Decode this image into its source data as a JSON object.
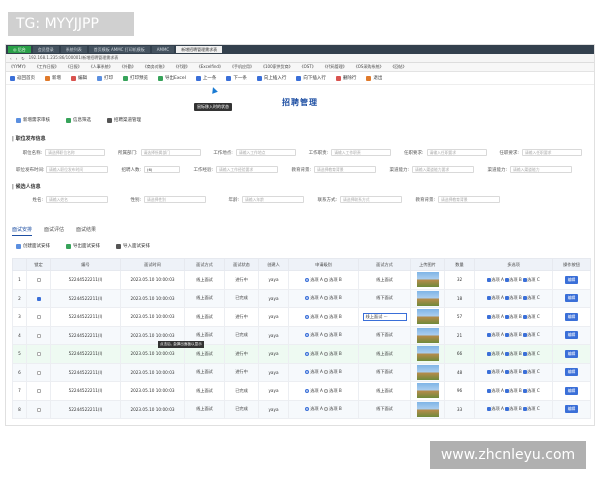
{
  "overlay": {
    "tag": "TG: MYYJJPP",
    "watermark": "www.zhcnleyu.com"
  },
  "browser": {
    "tabs": [
      "◎ 后台",
      "会员登录",
      "系统列表",
      "首页模板 AMMC 打印机模板",
      "AMMC",
      "新增招聘管理需求表"
    ],
    "address": "192.168.1.235:86/100001/新增招聘管理需求表",
    "bookmarks": [
      "《YYMY》",
      "《工作日报》",
      "《日报》",
      "《人事系统》",
      "《外勤》",
      "《商务对账》",
      "《代理》",
      "《Excelfind》",
      "《手机应用》",
      "《100家供货商》",
      "《OST》",
      "《代码管理》",
      "《OS采购系统》",
      "《回帖》"
    ]
  },
  "toolbar": {
    "items": [
      "返回首页",
      "新增",
      "编辑",
      "打印",
      "打印预览",
      "导出Excel",
      "上一条",
      "下一条",
      "向上插入行",
      "向下插入行",
      "删除行",
      "退出"
    ]
  },
  "tooltip": "鼠标移入时的状态",
  "page": {
    "title": "招聘管理"
  },
  "actions": [
    "新增需求审核",
    "信息筛选",
    "招聘渠道管理"
  ],
  "sections": {
    "job_info": "职位发布信息",
    "candidate": "候选人信息"
  },
  "job_form": {
    "row1": [
      {
        "label": "职位名称:",
        "placeholder": "请选择职位名称"
      },
      {
        "label": "所属部门:",
        "placeholder": "请选择所属部门"
      },
      {
        "label": "工作地点:",
        "placeholder": "请输入工作地点"
      },
      {
        "label": "工作职责:",
        "placeholder": "请输入工作职责"
      },
      {
        "label": "任职要求:",
        "placeholder": "请输入任职要求"
      },
      {
        "label": "任职要求:",
        "placeholder": "请输入任职要求"
      }
    ],
    "row2": [
      {
        "label": "职位发布时间:",
        "placeholder": "请输入职位发布时间"
      },
      {
        "label": "招聘人数:",
        "value": "(6)"
      },
      {
        "label": "工作经验:",
        "placeholder": "请输入工作经验要求"
      },
      {
        "label": "教育背景:",
        "placeholder": "请选择教育背景"
      },
      {
        "label": "渠道能力:",
        "placeholder": "请输入渠道能力要求"
      },
      {
        "label": "渠道能力:",
        "placeholder": "请输入渠道能力"
      }
    ]
  },
  "candidate_form": [
    {
      "label": "姓名:",
      "placeholder": "请输入姓名"
    },
    {
      "label": "性别:",
      "placeholder": "请选择性别"
    },
    {
      "label": "年龄:",
      "placeholder": "请输入年龄"
    },
    {
      "label": "联系方式:",
      "placeholder": "请选择联系方式"
    },
    {
      "label": "教育背景:",
      "placeholder": "请选择教育背景"
    }
  ],
  "lower_tabs": [
    "面试安排",
    "面试评估",
    "面试结果"
  ],
  "lower_actions": [
    "创建面试安排",
    "导出面试安排",
    "导入面试安排"
  ],
  "table": {
    "headers": [
      "",
      "锁定",
      "编号",
      "面试时间",
      "面试方式",
      "面试状态",
      "创建人",
      "申请级别",
      "面试方式",
      "上传图片",
      "数量",
      "多选项",
      "操作按钮"
    ],
    "rows": [
      {
        "n": "1",
        "code": "52244522211(I)",
        "time": "2023.05.10 10:00:03",
        "mode": "线上面试",
        "status": "进行中",
        "creator": "yaya",
        "level": "A",
        "way": "线上面试",
        "qty": "32"
      },
      {
        "n": "2",
        "code": "52244522211(I)",
        "time": "2023.05.10 10:00:03",
        "mode": "线上面试",
        "status": "已完成",
        "creator": "yaya",
        "level": "A",
        "way": "线下面试",
        "qty": "18"
      },
      {
        "n": "3",
        "code": "52244522211(I)",
        "time": "2023.05.10 10:00:03",
        "mode": "线上面试",
        "status": "进行中",
        "creator": "yaya",
        "level": "A",
        "way": "线上面试",
        "qty": "57"
      },
      {
        "n": "4",
        "code": "52244522211(I)",
        "time": "2023.05.10 10:00:03",
        "mode": "线上面试",
        "status": "已完成",
        "creator": "yaya",
        "level": "A",
        "way": "线下面试",
        "qty": "21"
      },
      {
        "n": "5",
        "code": "52244522211(I)",
        "time": "2023.05.10 10:00:03",
        "mode": "线上面试",
        "status": "进行中",
        "creator": "yaya",
        "level": "A",
        "way": "线上面试",
        "qty": "66"
      },
      {
        "n": "6",
        "code": "52244522211(I)",
        "time": "2023.05.10 10:00:03",
        "mode": "线上面试",
        "status": "进行中",
        "creator": "yaya",
        "level": "A",
        "way": "线下面试",
        "qty": "48"
      },
      {
        "n": "7",
        "code": "52244522211(I)",
        "time": "2023.05.10 10:00:03",
        "mode": "线上面试",
        "status": "已完成",
        "creator": "yaya",
        "level": "A",
        "way": "线上面试",
        "qty": "96"
      },
      {
        "n": "8",
        "code": "52244522211(I)",
        "time": "2023.05.10 10:00:03",
        "mode": "线上面试",
        "status": "已完成",
        "creator": "yaya",
        "level": "A",
        "way": "线下面试",
        "qty": "33"
      }
    ],
    "radio_a": "选项 A",
    "radio_b": "选项 B",
    "check_a": "选项 A",
    "check_b": "选项 B",
    "check_c": "选项 C",
    "edit": "编辑",
    "tip": "点击后, 会弹出面板以显示"
  }
}
